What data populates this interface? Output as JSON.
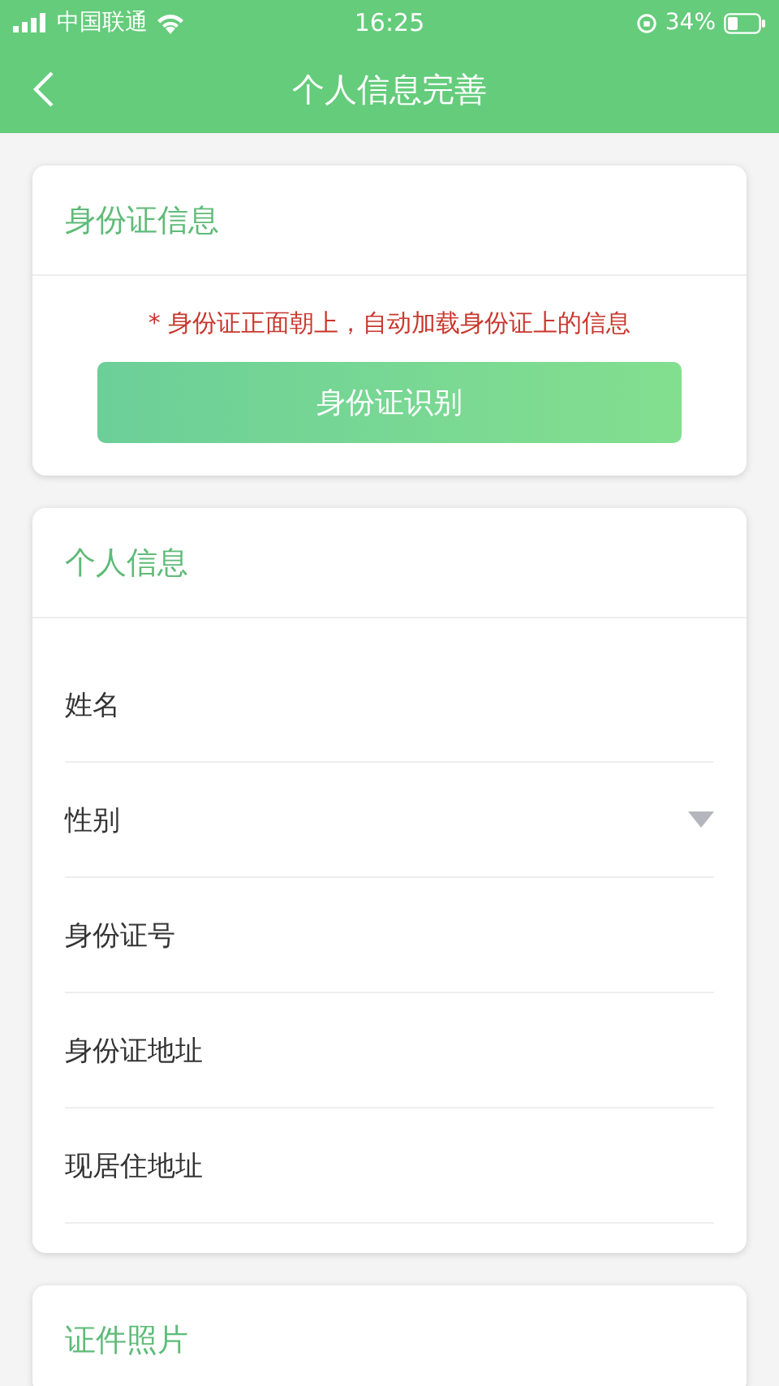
{
  "status_bar": {
    "carrier": "中国联通",
    "time": "16:25",
    "battery": "34%"
  },
  "nav": {
    "title": "个人信息完善"
  },
  "id_card": {
    "title": "身份证信息",
    "notice": "* 身份证正面朝上，自动加载身份证上的信息",
    "button": "身份证识别"
  },
  "personal": {
    "title": "个人信息",
    "fields": [
      {
        "label": "姓名",
        "kind": "text"
      },
      {
        "label": "性别",
        "kind": "select"
      },
      {
        "label": "身份证号",
        "kind": "text"
      },
      {
        "label": "身份证地址",
        "kind": "text"
      },
      {
        "label": "现居住地址",
        "kind": "text"
      }
    ]
  },
  "photos": {
    "title": "证件照片"
  }
}
